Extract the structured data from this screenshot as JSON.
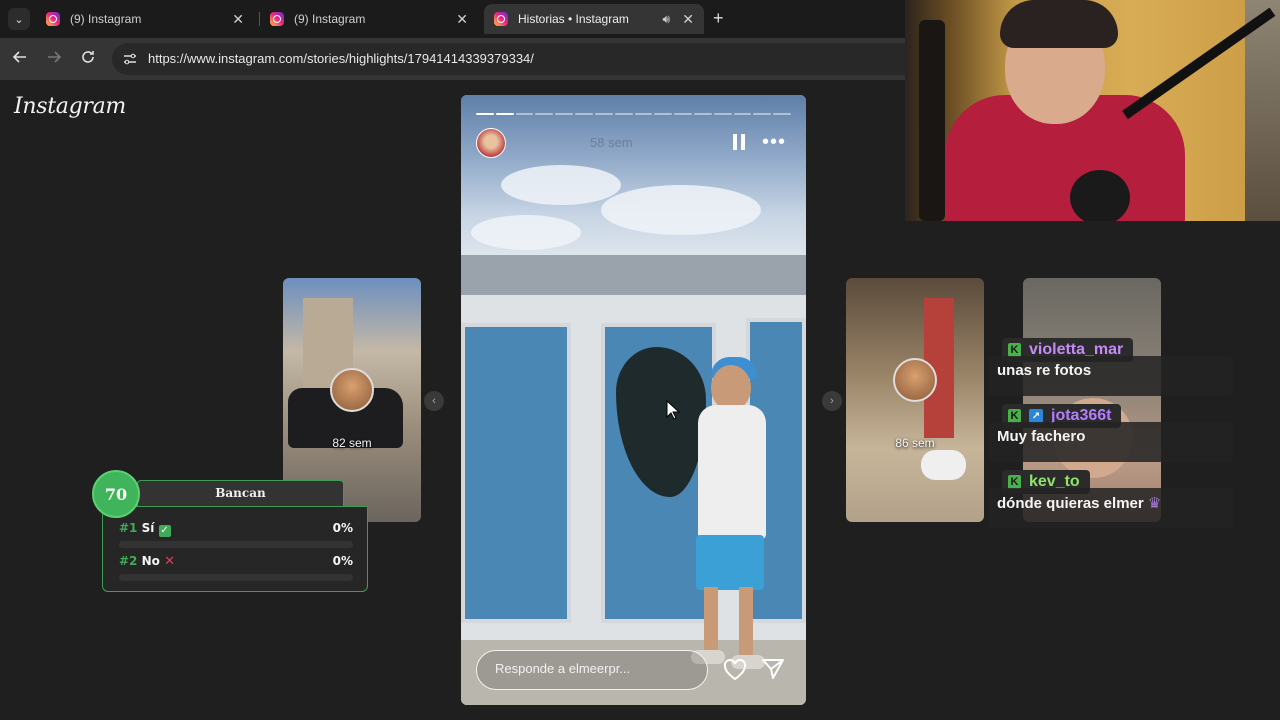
{
  "browser": {
    "tabs": [
      {
        "title": "(9) Instagram",
        "active": false
      },
      {
        "title": "(9) Instagram",
        "active": false
      },
      {
        "title": "Historias • Instagram",
        "active": true
      }
    ],
    "url": "https://www.instagram.com/stories/highlights/17941414339379334/"
  },
  "page": {
    "logo": "Instagram",
    "left_card_label": "82 sem",
    "right_card_label": "86 sem",
    "story": {
      "time": "58 sem",
      "progress_total": 16,
      "progress_done": 2,
      "reply_placeholder": "Responde a elmeerpr..."
    }
  },
  "poll": {
    "badge": "70",
    "title": "Bancan",
    "options": [
      {
        "num": "#1",
        "label": "Sí",
        "mark": "✓",
        "pct": "0%",
        "share": 0
      },
      {
        "num": "#2",
        "label": "No",
        "mark": "✕",
        "pct": "0%",
        "share": 0
      }
    ]
  },
  "chat": [
    {
      "user": "violetta_mar",
      "user_color": "#c58af9",
      "message": "unas re fotos"
    },
    {
      "user": "jota366t",
      "user_color": "#b47cff",
      "message": "Muy fachero"
    },
    {
      "user": "kev_to",
      "user_color": "#8fe36a",
      "message": "dónde quieras elmer"
    }
  ],
  "colors": {
    "poll_accent": "#3faa58",
    "chat_badge": "#4ab04a"
  }
}
